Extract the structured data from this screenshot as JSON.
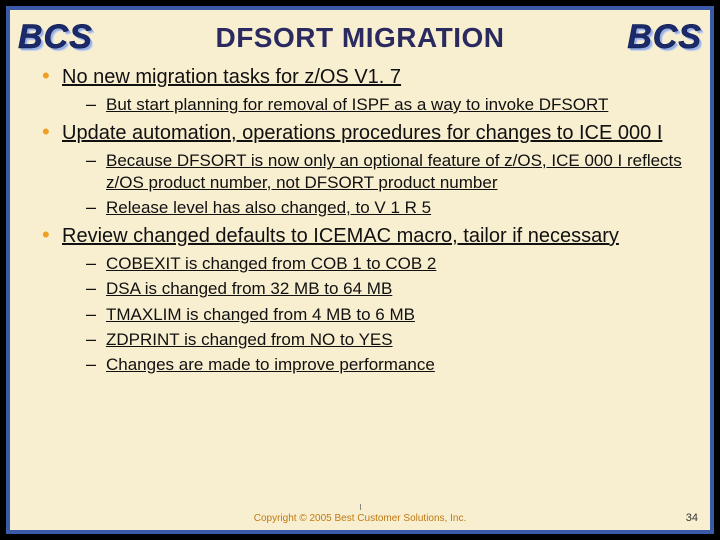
{
  "brand": "BCS",
  "title": "DFSORT MIGRATION",
  "bullets": [
    {
      "text": "No new migration tasks for z/OS V1. 7",
      "sub": [
        "But start planning for removal of ISPF as a way to invoke DFSORT"
      ]
    },
    {
      "text": "Update automation, operations procedures for changes to ICE 000 I",
      "sub": [
        "Because DFSORT is now only an optional feature of z/OS, ICE 000 I reflects z/OS product number, not DFSORT product number",
        "Release level has also changed, to V 1 R 5"
      ]
    },
    {
      "text": "Review changed defaults to ICEMAC macro, tailor if necessary",
      "sub": [
        "COBEXIT is changed from COB 1 to COB 2",
        "DSA is changed from 32 MB to 64 MB",
        "TMAXLIM is changed from 4 MB to 6 MB",
        "ZDPRINT is changed from NO to YES",
        "Changes are made to improve performance"
      ]
    }
  ],
  "footer": "Copyright © 2005 Best Customer Solutions, Inc.",
  "page": "34"
}
